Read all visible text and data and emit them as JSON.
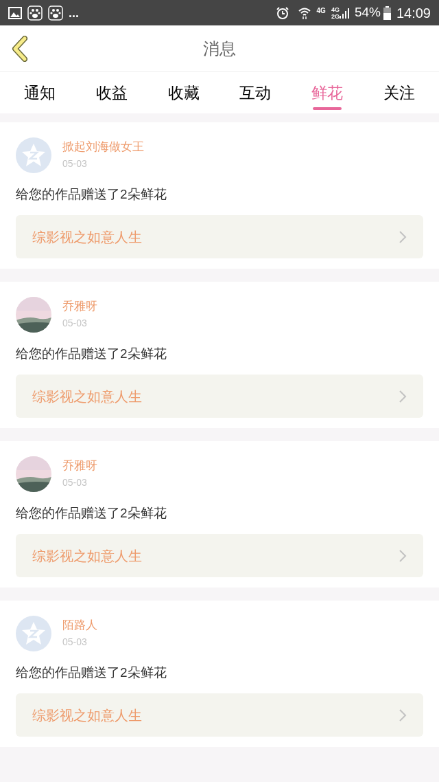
{
  "status_bar": {
    "more": "...",
    "network": "4G",
    "network_dual_top": "4G",
    "network_dual_bottom": "2G",
    "battery": "54%",
    "time": "14:09"
  },
  "header": {
    "title": "消息"
  },
  "tabs": [
    {
      "label": "通知",
      "selected": false
    },
    {
      "label": "收益",
      "selected": false
    },
    {
      "label": "收藏",
      "selected": false
    },
    {
      "label": "互动",
      "selected": false
    },
    {
      "label": "鲜花",
      "selected": true
    },
    {
      "label": "关注",
      "selected": false
    }
  ],
  "messages": [
    {
      "kind": "default",
      "name": "掀起刘海做女王",
      "date": "05-03",
      "text": "给您的作品赠送了2朵鲜花",
      "work": "综影视之如意人生"
    },
    {
      "name": "乔雅呀",
      "date": "05-03",
      "text": "给您的作品赠送了2朵鲜花",
      "work": "综影视之如意人生"
    },
    {
      "name": "乔雅呀",
      "date": "05-03",
      "text": "给您的作品赠送了2朵鲜花",
      "work": "综影视之如意人生"
    },
    {
      "kind": "default",
      "name": "陌路人",
      "date": "05-03",
      "text": "给您的作品赠送了2朵鲜花",
      "work": "综影视之如意人生"
    }
  ]
}
